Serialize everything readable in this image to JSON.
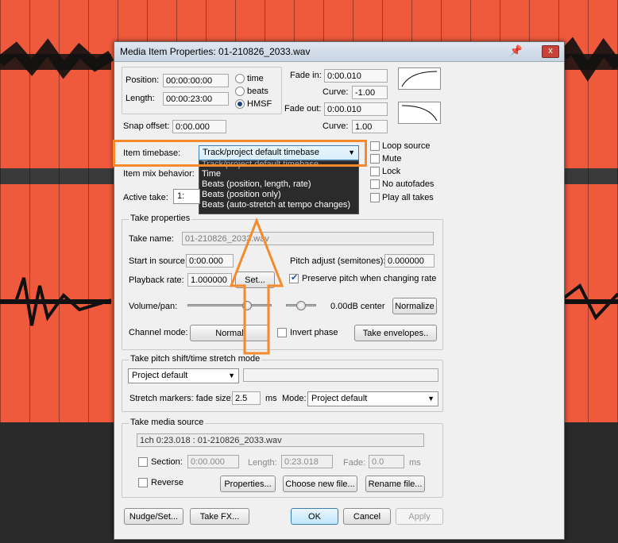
{
  "colors": {
    "track": "#f05a3c",
    "highlight": "#f58a2c",
    "accent": "#3c7fb1"
  },
  "dialog": {
    "title": "Media Item Properties:  01-210826_2033.wav",
    "pin_icon": "pin-icon",
    "close_label": "x"
  },
  "position": {
    "label": "Position:",
    "value": "00:00:00:00"
  },
  "length": {
    "label": "Length:",
    "value": "00:00:23:00"
  },
  "units": {
    "time": "time",
    "beats": "beats",
    "hmsf": "HMSF",
    "selected": "HMSF"
  },
  "fade_in": {
    "label": "Fade in:",
    "value": "0:00.010",
    "curve_label": "Curve:",
    "curve_value": "-1.00"
  },
  "fade_out": {
    "label": "Fade out:",
    "value": "0:00.010",
    "curve_label": "Curve:",
    "curve_value": "1.00"
  },
  "snap_offset": {
    "label": "Snap offset:",
    "value": "0:00.000"
  },
  "item_timebase": {
    "label": "Item timebase:",
    "value": "Track/project default timebase",
    "options": [
      "Track/project default timebase",
      "Time",
      "Beats (position, length, rate)",
      "Beats (position only)",
      "Beats (auto-stretch at tempo changes)"
    ]
  },
  "item_mix_behavior": {
    "label": "Item mix behavior:"
  },
  "active_take": {
    "label": "Active take:",
    "value": "1: 01-"
  },
  "flags": {
    "loop_source": "Loop source",
    "mute": "Mute",
    "lock": "Lock",
    "no_autofades": "No autofades",
    "play_all_takes": "Play all takes"
  },
  "take_properties": {
    "group_label": "Take properties",
    "take_name_label": "Take name:",
    "take_name": "01-210826_2033.wav",
    "start_in_source_label": "Start in source:",
    "start_in_source": "0:00.000",
    "pitch_adjust_label": "Pitch adjust (semitones):",
    "pitch_adjust": "0.000000",
    "playback_rate_label": "Playback rate:",
    "playback_rate": "1.000000",
    "set_button": "Set...",
    "preserve_pitch": "Preserve pitch when changing rate",
    "volume_pan_label": "Volume/pan:",
    "volume_pan_readout": "0.00dB  center",
    "volume_level": 0.82,
    "pan_level": 0.5,
    "normalize_button": "Normalize",
    "channel_mode_label": "Channel mode:",
    "channel_mode_value": "Normal",
    "invert_phase": "Invert phase",
    "take_envelopes_button": "Take envelopes.."
  },
  "pitch_shift": {
    "group_label": "Take pitch shift/time stretch mode",
    "mode_value": "Project default",
    "stretch_markers_label": "Stretch markers: fade size:",
    "fade_size": "2.5",
    "ms": "ms",
    "mode_label": "Mode:",
    "mode2_value": "Project default"
  },
  "media_source": {
    "group_label": "Take media source",
    "source": "1ch 0:23.018 : 01-210826_2033.wav",
    "section_label": "Section:",
    "section_value": "0:00.000",
    "length_label": "Length:",
    "length_value": "0:23.018",
    "fade_label": "Fade:",
    "fade_value": "0.0",
    "ms": "ms",
    "reverse_label": "Reverse",
    "properties_button": "Properties...",
    "choose_file_button": "Choose new file...",
    "rename_file_button": "Rename file..."
  },
  "footer": {
    "nudge_button": "Nudge/Set...",
    "take_fx_button": "Take FX...",
    "ok_button": "OK",
    "cancel_button": "Cancel",
    "apply_button": "Apply"
  }
}
